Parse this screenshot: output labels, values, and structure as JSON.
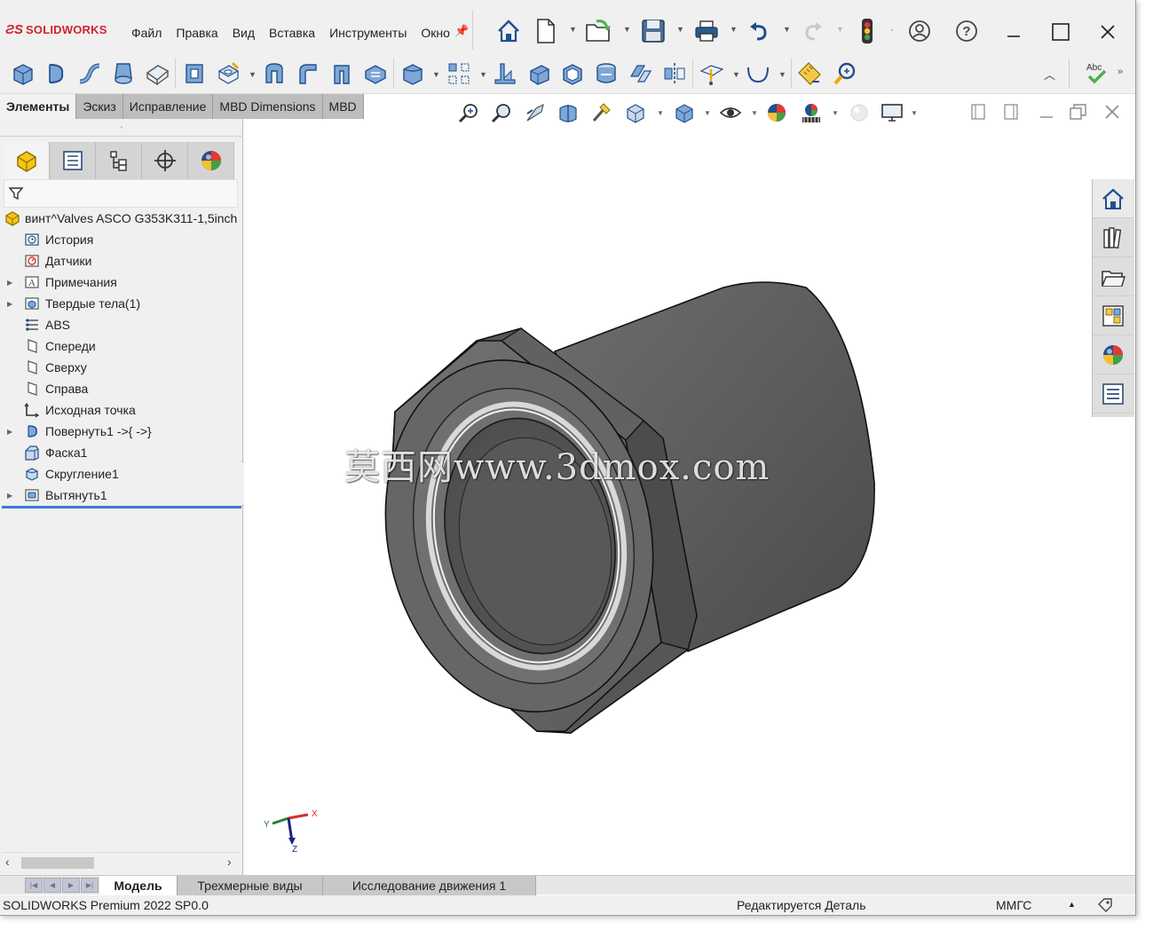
{
  "app": {
    "logo_ds": "ƧS",
    "logo_text": "SOLIDWORKS"
  },
  "menu": [
    "Файл",
    "Правка",
    "Вид",
    "Вставка",
    "Инструменты",
    "Окно"
  ],
  "feature_tabs": [
    {
      "label": "Элементы",
      "active": true
    },
    {
      "label": "Эскиз",
      "active": false
    },
    {
      "label": "Исправление",
      "active": false
    },
    {
      "label": "MBD Dimensions",
      "active": false
    },
    {
      "label": "MBD",
      "active": false
    }
  ],
  "tree": {
    "root": "винт^Valves ASCO G353K311-1,5inch",
    "items": [
      {
        "label": "История",
        "icon": "history-icon",
        "expandable": false
      },
      {
        "label": "Датчики",
        "icon": "sensors-icon",
        "expandable": false
      },
      {
        "label": "Примечания",
        "icon": "annotations-icon",
        "expandable": true
      },
      {
        "label": "Твердые тела(1)",
        "icon": "solid-bodies-icon",
        "expandable": true
      },
      {
        "label": "ABS",
        "icon": "material-icon",
        "expandable": false
      },
      {
        "label": "Спереди",
        "icon": "plane-icon",
        "expandable": false
      },
      {
        "label": "Сверху",
        "icon": "plane-icon",
        "expandable": false
      },
      {
        "label": "Справа",
        "icon": "plane-icon",
        "expandable": false
      },
      {
        "label": "Исходная точка",
        "icon": "origin-icon",
        "expandable": false
      },
      {
        "label": "Повернуть1 ->{ ->}",
        "icon": "revolve-icon",
        "expandable": true
      },
      {
        "label": "Фаска1",
        "icon": "chamfer-icon",
        "expandable": false
      },
      {
        "label": "Скругление1",
        "icon": "fillet-icon",
        "expandable": false
      },
      {
        "label": "Вытянуть1",
        "icon": "extrude-icon",
        "expandable": true
      }
    ]
  },
  "bottom_tabs": [
    {
      "label": "Модель",
      "active": true
    },
    {
      "label": "Трехмерные виды",
      "active": false
    },
    {
      "label": "Исследование движения 1",
      "active": false
    }
  ],
  "status": {
    "product": "SOLIDWORKS Premium 2022 SP0.0",
    "mode": "Редактируется Деталь",
    "units": "ММГС",
    "units_arrow": "▲"
  },
  "triad": {
    "x": "X",
    "y": "Y",
    "z": "Z"
  },
  "watermark": "莫西网www.3dmox.com",
  "colors": {
    "brand": "#d0232f",
    "part_gray": "#5e5e5e",
    "rollback_bar": "#3a7bd5",
    "panel_bg": "#f0f0f0"
  }
}
